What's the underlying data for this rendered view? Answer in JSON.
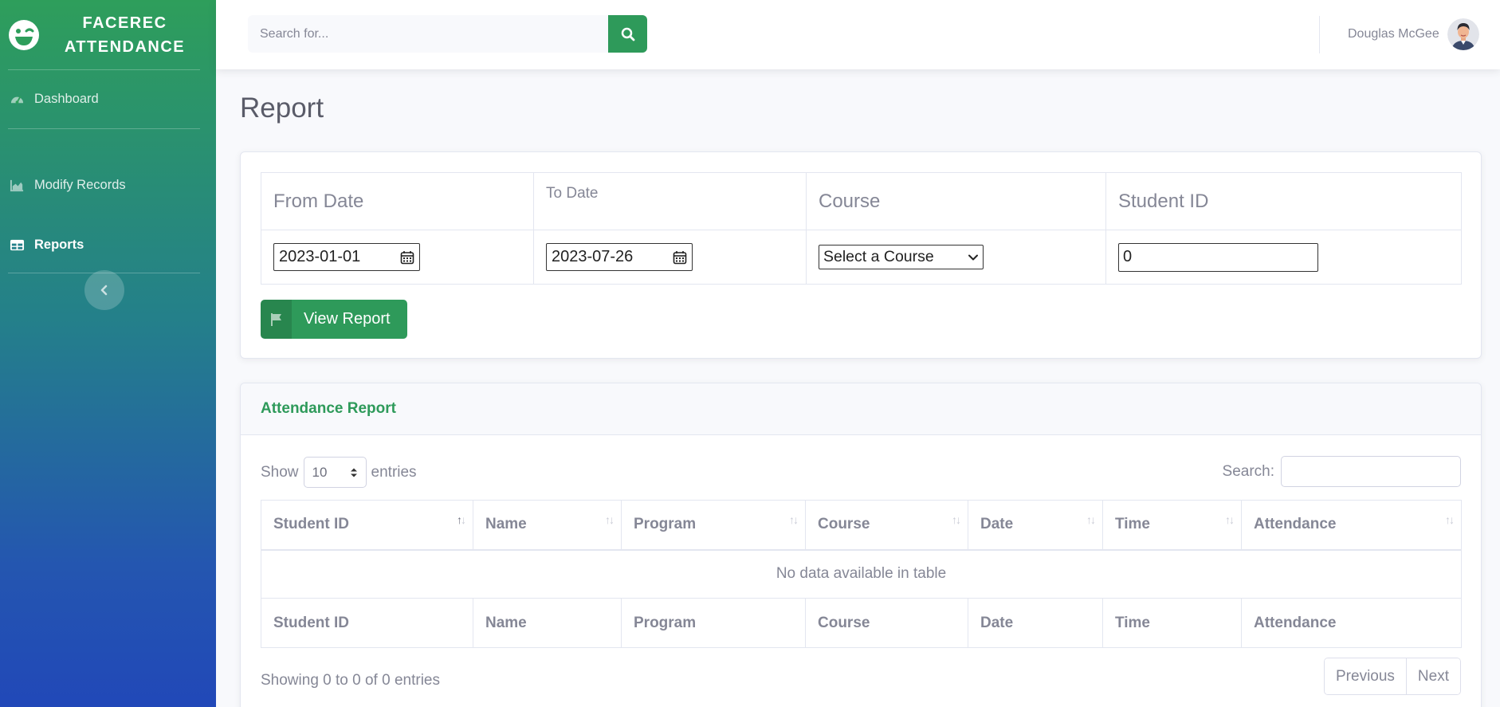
{
  "brand": {
    "line1": "FACEREC",
    "line2": "ATTENDANCE"
  },
  "sidebar": {
    "items": [
      {
        "label": "Dashboard",
        "icon": "gauge-icon"
      },
      {
        "label": "Modify Records",
        "icon": "area-chart-icon"
      },
      {
        "label": "Reports",
        "icon": "table-icon",
        "active": true
      }
    ],
    "toggle_icon": "chevron-left-icon"
  },
  "topbar": {
    "search_placeholder": "Search for...",
    "user_name": "Douglas McGee"
  },
  "page": {
    "title": "Report"
  },
  "filters": {
    "headers": {
      "from_date": "From Date",
      "to_date": "To Date",
      "course": "Course",
      "student_id": "Student ID"
    },
    "from_date_value": "2023-01-01",
    "to_date_value": "2023-07-26",
    "course_selected": "Select a Course",
    "student_id_value": "0",
    "view_button": "View Report"
  },
  "report": {
    "title": "Attendance Report",
    "show_label": "Show",
    "entries_label": "entries",
    "length_value": "10",
    "search_label": "Search:",
    "columns": [
      "Student ID",
      "Name",
      "Program",
      "Course",
      "Date",
      "Time",
      "Attendance"
    ],
    "empty_message": "No data available in table",
    "info": "Showing 0 to 0 of 0 entries",
    "pagination": {
      "previous": "Previous",
      "next": "Next"
    }
  },
  "colors": {
    "accent": "#2e9a5a",
    "sidebar_top": "#2e9e5b",
    "sidebar_bottom": "#2148b8"
  }
}
